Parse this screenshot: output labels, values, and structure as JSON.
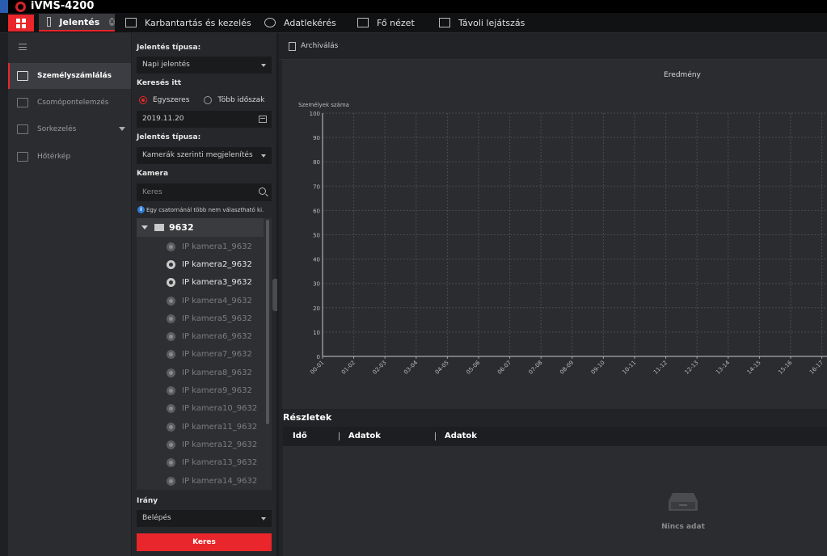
{
  "app": {
    "title": "iVMS-4200"
  },
  "tabs": [
    {
      "label": "Jelentés",
      "active": true
    },
    {
      "label": "Karbantartás és kezelés"
    },
    {
      "label": "Adatlekérés"
    },
    {
      "label": "Fő nézet"
    },
    {
      "label": "Távoli lejátszás"
    }
  ],
  "nav": [
    {
      "label": "Személyszámlálás",
      "icon": "people-count-icon",
      "active": true
    },
    {
      "label": "Csomópontelemzés",
      "icon": "intersection-icon"
    },
    {
      "label": "Sorkezelés",
      "icon": "queue-icon",
      "expandable": true
    },
    {
      "label": "Hőtérkép",
      "icon": "heatmap-icon"
    }
  ],
  "filters": {
    "report_type_label": "Jelentés típusa:",
    "report_type_value": "Napi jelentés",
    "search_in_label": "Keresés itt",
    "radio_single": "Egyszeres",
    "radio_multi": "Több időszak",
    "date_value": "2019.11.20",
    "display_type_label": "Jelentés típusa:",
    "display_type_value": "Kamerák szerinti megjelenítés",
    "camera_label": "Kamera",
    "camera_search_placeholder": "Keres",
    "info_text": "Egy csatornánál több nem választható ki.",
    "direction_label": "Irány",
    "direction_value": "Belépés",
    "search_button": "Keres"
  },
  "tree": {
    "root": "9632",
    "cameras": [
      {
        "label": "IP kamera1_9632",
        "online": false
      },
      {
        "label": "IP kamera2_9632",
        "online": true
      },
      {
        "label": "IP kamera3_9632",
        "online": true
      },
      {
        "label": "IP kamera4_9632",
        "online": false
      },
      {
        "label": "IP kamera5_9632",
        "online": false
      },
      {
        "label": "IP kamera6_9632",
        "online": false
      },
      {
        "label": "IP kamera7_9632",
        "online": false
      },
      {
        "label": "IP kamera8_9632",
        "online": false
      },
      {
        "label": "IP kamera9_9632",
        "online": false
      },
      {
        "label": "IP kamera10_9632",
        "online": false
      },
      {
        "label": "IP kamera11_9632",
        "online": false
      },
      {
        "label": "IP kamera12_9632",
        "online": false
      },
      {
        "label": "IP kamera13_9632",
        "online": false
      },
      {
        "label": "IP kamera14_9632",
        "online": false
      }
    ]
  },
  "main": {
    "export_label": "Archiválás",
    "details_title": "Részletek",
    "columns": [
      "Idő",
      "Adatok",
      "Adatok"
    ],
    "empty_text": "Nincs adat"
  },
  "chart_data": {
    "type": "line",
    "title": "Eredmény",
    "ylabel": "Személyek száma",
    "xlabel": "",
    "ylim": [
      0,
      100
    ],
    "yticks": [
      0,
      10,
      20,
      30,
      40,
      50,
      60,
      70,
      80,
      90,
      100
    ],
    "categories": [
      "00-01",
      "01-02",
      "02-03",
      "03-04",
      "04-05",
      "05-06",
      "06-07",
      "07-08",
      "08-09",
      "09-10",
      "10-11",
      "11-12",
      "12-13",
      "13-14",
      "14-15",
      "15-16",
      "16-17"
    ],
    "series": [],
    "grid": true
  },
  "colors": {
    "accent": "#e8262b",
    "background": "#1f2023",
    "panel": "#2b2c30"
  }
}
